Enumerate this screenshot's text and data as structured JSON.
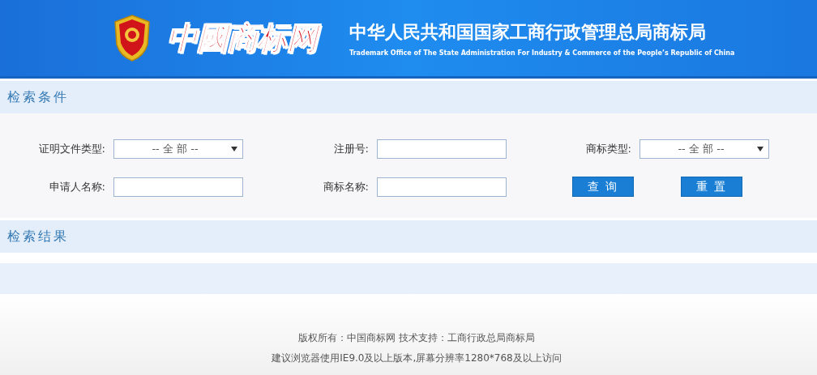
{
  "header": {
    "logo": "中國商标网",
    "title": "中华人民共和国国家工商行政管理总局商标局",
    "subtitle": "Trademark Office of The State Administration For Industry & Commerce of the People’s Republic of China"
  },
  "search_section": {
    "title": "检索条件",
    "fields": [
      {
        "kind": "select",
        "label": "证明文件类型:",
        "value": "-- 全 部 --"
      },
      {
        "kind": "input",
        "label": "注册号:"
      },
      {
        "kind": "select",
        "label": "商标类型:",
        "value": "-- 全 部 --"
      },
      {
        "kind": "input",
        "label": "申请人名称:"
      },
      {
        "kind": "input",
        "label": "商标名称:"
      }
    ],
    "buttons": [
      "查 询",
      "重 置"
    ]
  },
  "results_section": {
    "title": "检索结果"
  },
  "footer": {
    "lines": [
      "版权所有：中国商标网 技术支持：工商行政总局商标局",
      "建议浏览器使用IE9.0及以上版本,屏幕分辨率1280*768及以上访问"
    ]
  }
}
